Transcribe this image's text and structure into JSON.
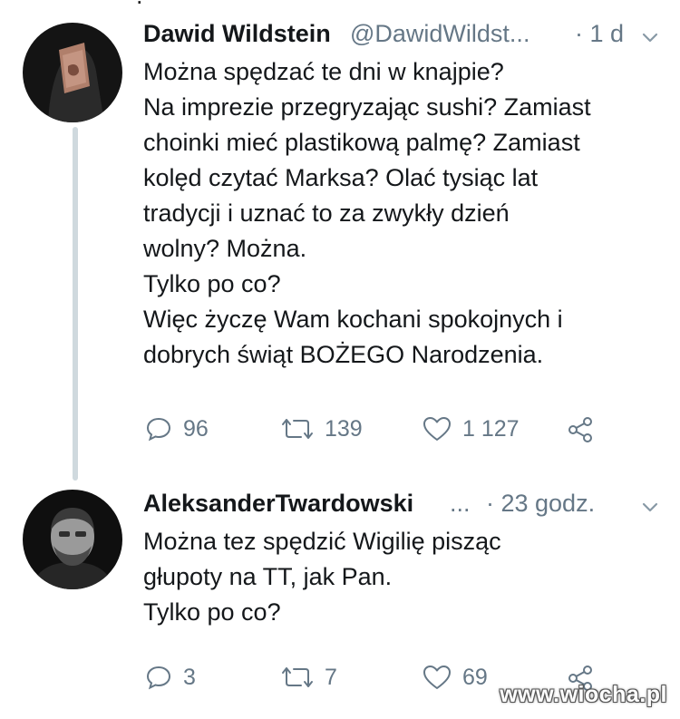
{
  "tweets": [
    {
      "name": "Dawid Wildstein",
      "handle": "@DawidWildst...",
      "time": "· 1 d",
      "body": [
        "Można spędzać te dni w knajpie?",
        "Na imprezie przegryzając sushi? Zamiast",
        "choinki mieć plastikową palmę? Zamiast",
        "kolęd czytać Marksa? Olać tysiąc lat",
        "tradycji i uznać to za zwykły dzień",
        "wolny? Można.",
        "Tylko po co?",
        "Więc życzę Wam kochani spokojnych i",
        "dobrych świąt BOŻEGO Narodzenia."
      ],
      "actions": {
        "replies": "96",
        "retweets": "139",
        "likes": "1 127"
      }
    },
    {
      "name": "AleksanderTwardowski",
      "handle": "...",
      "time": "· 23 godz.",
      "body": [
        "Można tez spędzić Wigilię pisząc",
        "głupoty na TT, jak Pan.",
        "Tylko po co?"
      ],
      "actions": {
        "replies": "3",
        "retweets": "7",
        "likes": "69"
      }
    }
  ],
  "watermark": "www.wiocha.pl",
  "icons": {
    "reply": "reply-icon",
    "retweet": "retweet-icon",
    "like": "heart-icon",
    "share": "share-icon",
    "caret": "chevron-down-icon"
  },
  "colors": {
    "text": "#14171a",
    "muted": "#657786",
    "thread_line": "#cfd9de"
  }
}
